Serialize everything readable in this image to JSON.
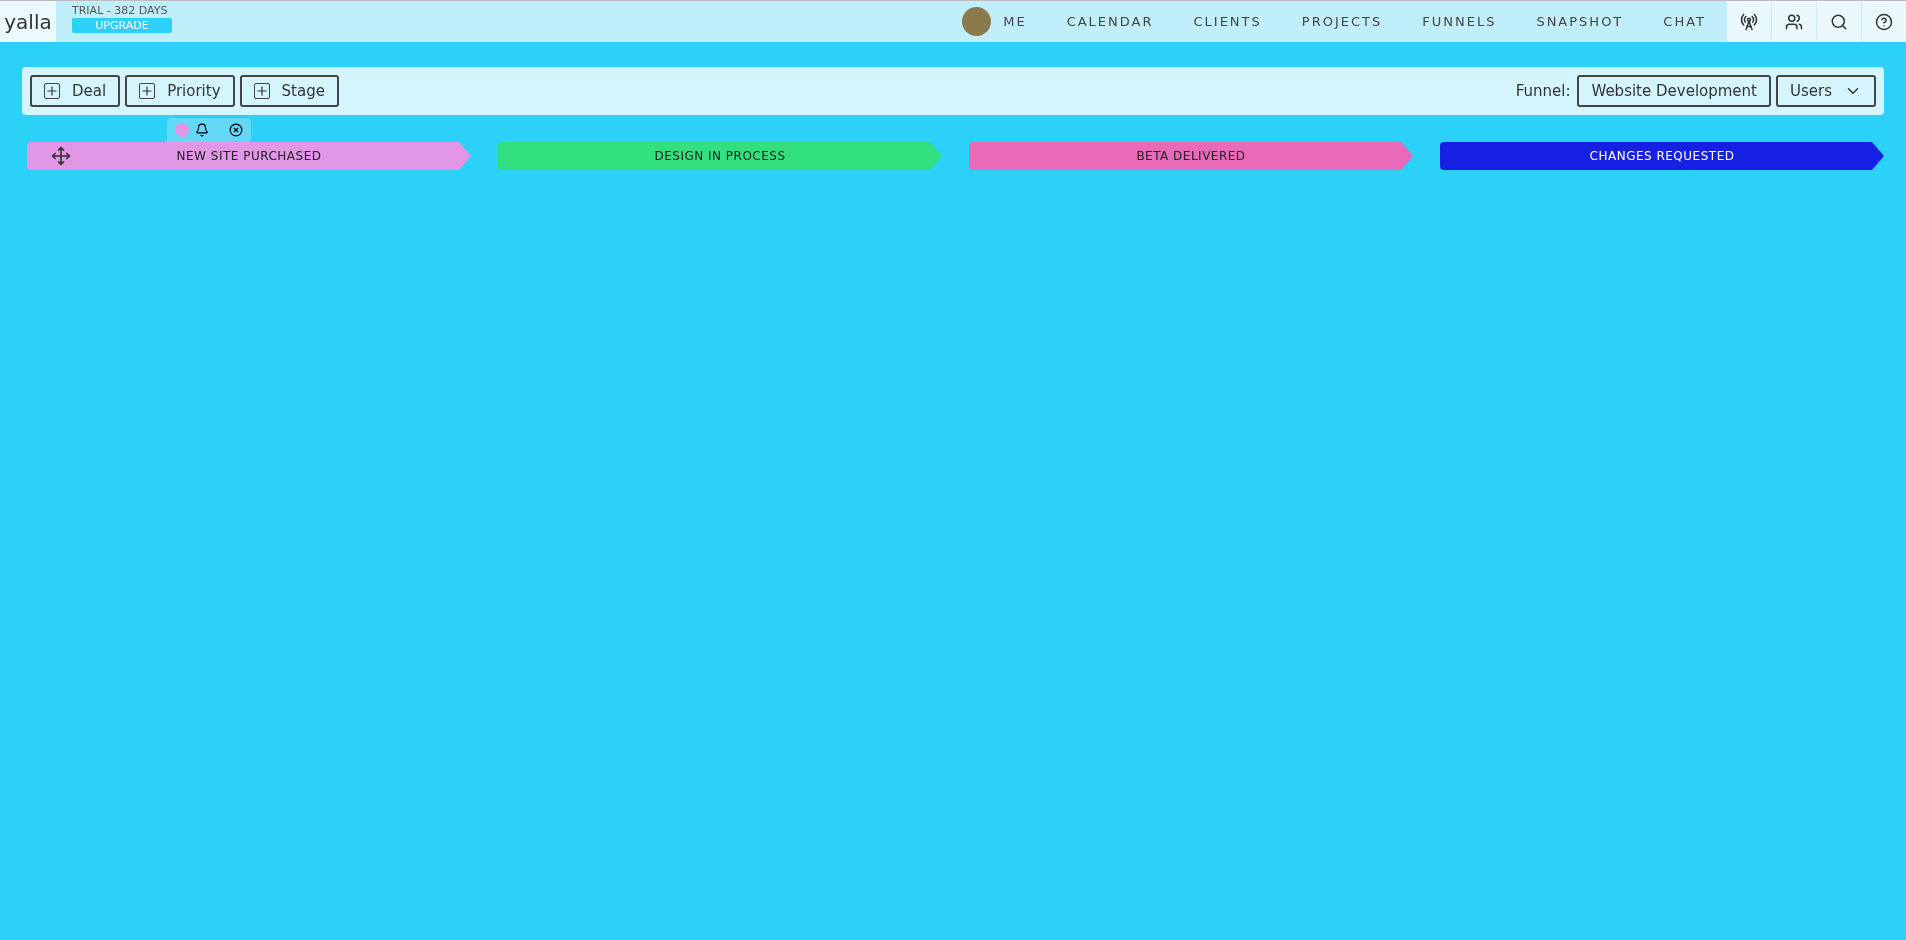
{
  "brand": {
    "logo": "yalla",
    "trial": "TRIAL - 382 DAYS",
    "upgrade": "UPGRADE"
  },
  "nav": {
    "items": [
      {
        "label": "ME",
        "kind": "avatar"
      },
      {
        "label": "CALENDAR",
        "kind": "link"
      },
      {
        "label": "CLIENTS",
        "kind": "link"
      },
      {
        "label": "PROJECTS",
        "kind": "link"
      },
      {
        "label": "FUNNELS",
        "kind": "link"
      },
      {
        "label": "SNAPSHOT",
        "kind": "link"
      },
      {
        "label": "CHAT",
        "kind": "link"
      }
    ]
  },
  "toolbar": {
    "buttons": [
      "Deal",
      "Priority",
      "Stage"
    ],
    "funnel_label": "Funnel:",
    "funnel": "Website Development",
    "users": "Users"
  },
  "stages": [
    {
      "label": "NEW SITE PURCHASED",
      "color": "#e196e6",
      "hovered": true
    },
    {
      "label": "DESIGN IN PROCESS",
      "color": "#33e080",
      "hovered": false
    },
    {
      "label": "BETA DELIVERED",
      "color": "#e86ab9",
      "hovered": false
    },
    {
      "label": "CHANGES REQUESTED",
      "color": "#1620e3",
      "hovered": false
    }
  ]
}
